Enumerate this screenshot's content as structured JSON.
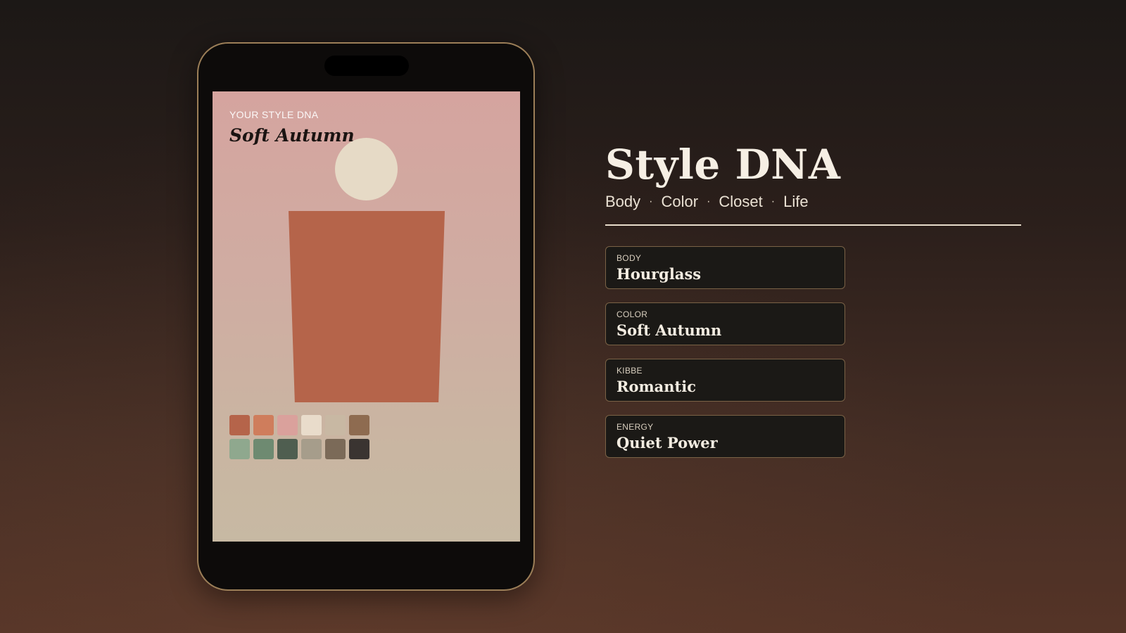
{
  "phone": {
    "eyebrow": "YOUR STYLE DNA",
    "title": "Soft Autumn",
    "figure": {
      "head_color": "#e6dac6",
      "torso_color": "#b5644a"
    },
    "palette": [
      "#b5644a",
      "#cf7d5c",
      "#daa19c",
      "#e9dccb",
      "#c8b8a3",
      "#8e6b50",
      "#8fa88e",
      "#6e8a71",
      "#4f5e50",
      "#a69d8b",
      "#7b6a58",
      "#3a3431"
    ]
  },
  "hero": {
    "title": "Style DNA",
    "tagline": [
      "Body",
      "Color",
      "Closet",
      "Life"
    ],
    "separator": "·"
  },
  "cards": [
    {
      "label": "BODY",
      "value": "Hourglass"
    },
    {
      "label": "COLOR",
      "value": "Soft Autumn"
    },
    {
      "label": "KIBBE",
      "value": "Romantic"
    },
    {
      "label": "ENERGY",
      "value": "Quiet Power"
    }
  ],
  "colors": {
    "phone_border": "#9c7f58",
    "card_border": "#7a6246",
    "text_light": "#f6efe4"
  }
}
